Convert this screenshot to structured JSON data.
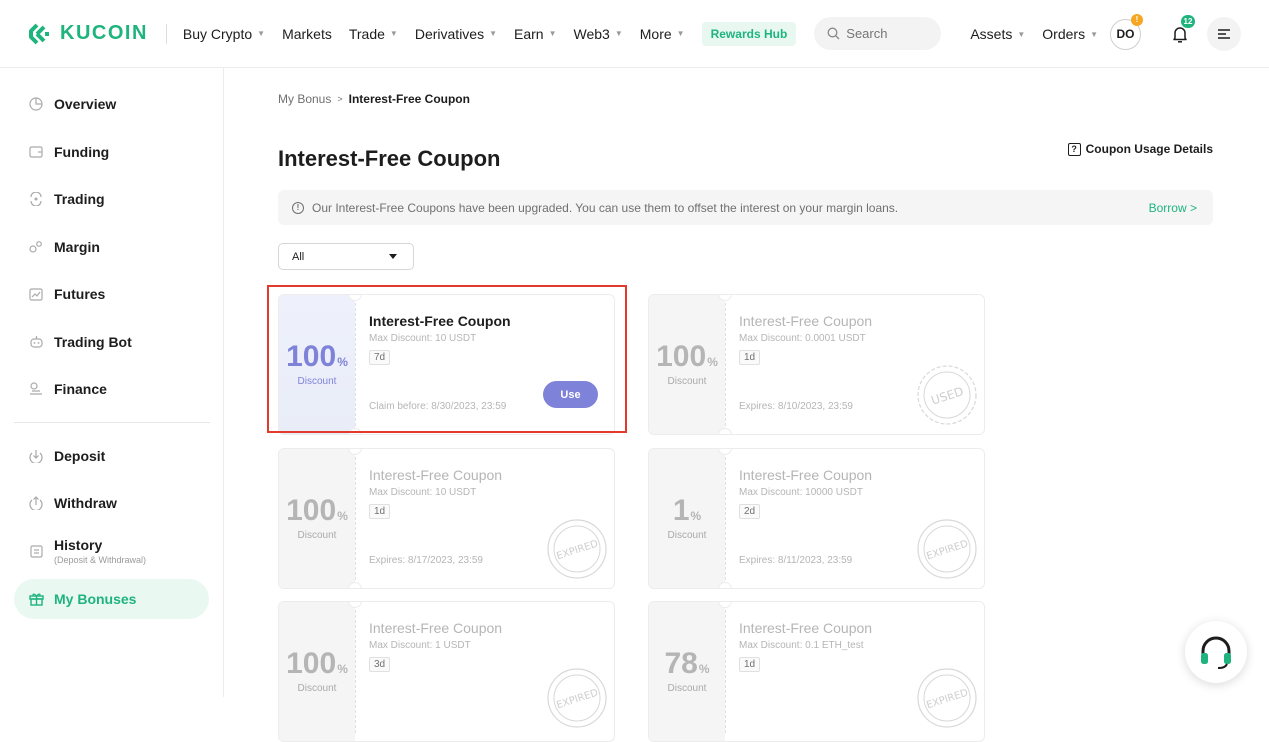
{
  "brand": {
    "name": "KUCOIN",
    "color": "#1fb47e"
  },
  "nav": {
    "items": [
      {
        "label": "Buy Crypto",
        "dropdown": true
      },
      {
        "label": "Markets",
        "dropdown": false
      },
      {
        "label": "Trade",
        "dropdown": true
      },
      {
        "label": "Derivatives",
        "dropdown": true
      },
      {
        "label": "Earn",
        "dropdown": true
      },
      {
        "label": "Web3",
        "dropdown": true
      },
      {
        "label": "More",
        "dropdown": true
      }
    ],
    "rewards_hub": "Rewards Hub",
    "search_placeholder": "Search",
    "assets": "Assets",
    "orders": "Orders",
    "avatar_initials": "DO",
    "avatar_badge": "!",
    "notification_count": "12"
  },
  "sidebar": {
    "items": [
      {
        "label": "Overview",
        "icon": "pie-chart-icon"
      },
      {
        "label": "Funding",
        "icon": "wallet-icon"
      },
      {
        "label": "Trading",
        "icon": "trading-icon"
      },
      {
        "label": "Margin",
        "icon": "margin-icon"
      },
      {
        "label": "Futures",
        "icon": "futures-icon"
      },
      {
        "label": "Trading Bot",
        "icon": "bot-icon"
      },
      {
        "label": "Finance",
        "icon": "finance-icon"
      },
      {
        "label": "Deposit",
        "icon": "deposit-icon"
      },
      {
        "label": "Withdraw",
        "icon": "withdraw-icon"
      },
      {
        "label": "History",
        "sub": "(Deposit & Withdrawal)",
        "icon": "history-icon"
      },
      {
        "label": "My Bonuses",
        "icon": "gift-icon",
        "active": true
      }
    ]
  },
  "main": {
    "breadcrumb": {
      "parent": "My Bonus",
      "current": "Interest-Free Coupon"
    },
    "title": "Interest-Free Coupon",
    "usage_link": "Coupon Usage Details",
    "notice": "Our Interest-Free Coupons have been upgraded. You can use them to offset the interest on your margin loans.",
    "borrow_link": "Borrow",
    "filter_value": "All",
    "coupons": [
      {
        "pct": "100",
        "unit": "%",
        "discount": "Discount",
        "name": "Interest-Free Coupon",
        "max": "Max Discount: 10 USDT",
        "days": "7d",
        "expiry": "Claim before: 8/30/2023, 23:59",
        "action": "Use",
        "status": "active"
      },
      {
        "pct": "100",
        "unit": "%",
        "discount": "Discount",
        "name": "Interest-Free Coupon",
        "max": "Max Discount: 0.0001 USDT",
        "days": "1d",
        "expiry": "Expires: 8/10/2023, 23:59",
        "status": "used",
        "stamp": "USED"
      },
      {
        "pct": "100",
        "unit": "%",
        "discount": "Discount",
        "name": "Interest-Free Coupon",
        "max": "Max Discount: 10 USDT",
        "days": "1d",
        "expiry": "Expires: 8/17/2023, 23:59",
        "status": "expired",
        "stamp": "EXPIRED"
      },
      {
        "pct": "1",
        "unit": "%",
        "discount": "Discount",
        "name": "Interest-Free Coupon",
        "max": "Max Discount: 10000 USDT",
        "days": "2d",
        "expiry": "Expires: 8/11/2023, 23:59",
        "status": "expired",
        "stamp": "EXPIRED"
      },
      {
        "pct": "100",
        "unit": "%",
        "discount": "Discount",
        "name": "Interest-Free Coupon",
        "max": "Max Discount: 1 USDT",
        "days": "3d",
        "expiry": "",
        "status": "expired",
        "stamp": "EXPIRED"
      },
      {
        "pct": "78",
        "unit": "%",
        "discount": "Discount",
        "name": "Interest-Free Coupon",
        "max": "Max Discount: 0.1 ETH_test",
        "days": "1d",
        "expiry": "",
        "status": "expired",
        "stamp": "EXPIRED"
      }
    ]
  }
}
